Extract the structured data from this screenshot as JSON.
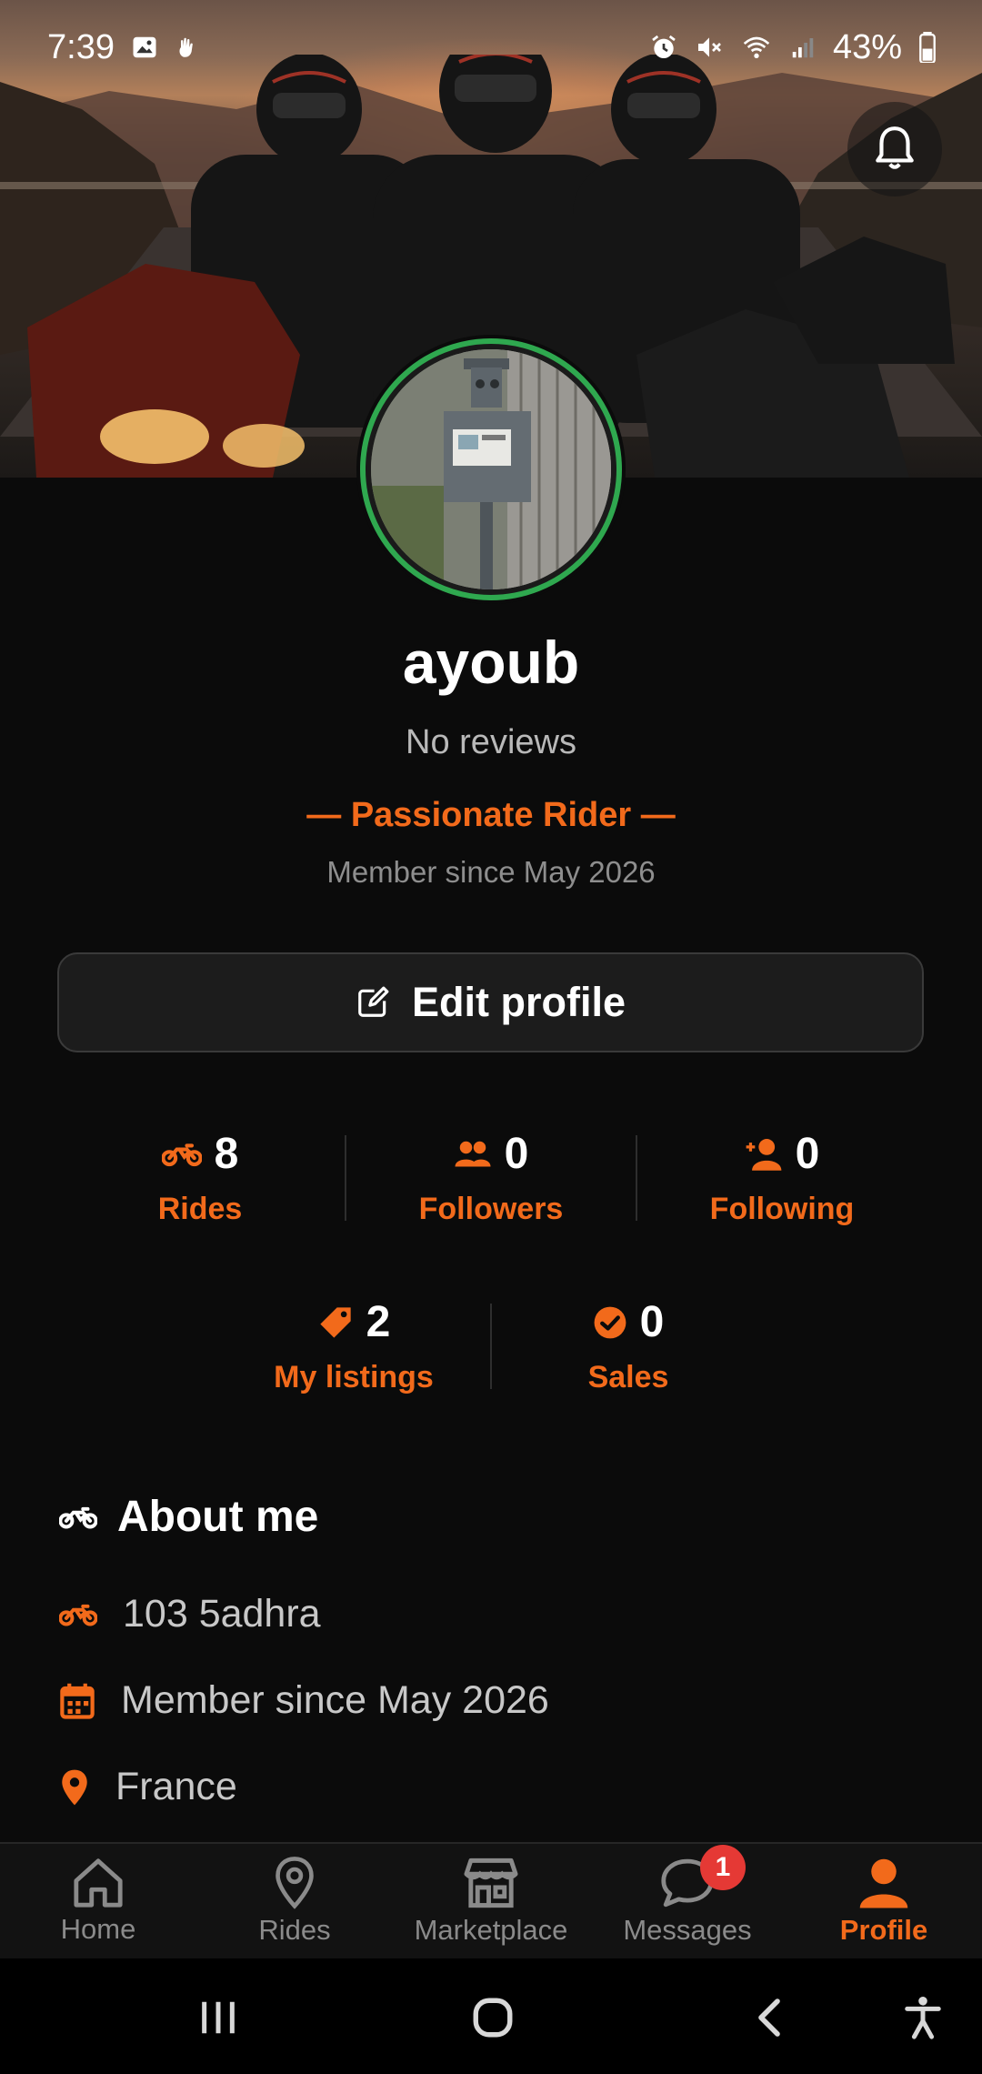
{
  "status_bar": {
    "time": "7:39",
    "battery": "43%",
    "left_icons": [
      "gallery-icon",
      "hand-icon"
    ],
    "right_icons": [
      "alarm-icon",
      "mute-icon",
      "wifi-icon",
      "signal-icon",
      "battery-icon"
    ]
  },
  "profile": {
    "username": "ayoub",
    "reviews": "No reviews",
    "title": "— Passionate Rider —",
    "member_since": "Member since May 2026"
  },
  "edit_profile": {
    "label": "Edit profile",
    "icon": "edit-icon"
  },
  "stats_primary": [
    {
      "icon": "motorcycle-icon",
      "value": "8",
      "label": "Rides"
    },
    {
      "icon": "followers-icon",
      "value": "0",
      "label": "Followers"
    },
    {
      "icon": "add-user-icon",
      "value": "0",
      "label": "Following"
    }
  ],
  "stats_secondary": [
    {
      "icon": "tag-icon",
      "value": "2",
      "label": "My listings"
    },
    {
      "icon": "check-circle-icon",
      "value": "0",
      "label": "Sales"
    }
  ],
  "about": {
    "heading": "About me",
    "items": [
      {
        "icon": "motorcycle-icon",
        "text": "103 5adhra"
      },
      {
        "icon": "calendar-icon",
        "text": "Member since May 2026"
      },
      {
        "icon": "location-pin-icon",
        "text": "France"
      }
    ]
  },
  "bottom_nav": {
    "items": [
      {
        "icon": "home-icon",
        "label": "Home"
      },
      {
        "icon": "map-pin-icon",
        "label": "Rides"
      },
      {
        "icon": "store-icon",
        "label": "Marketplace"
      },
      {
        "icon": "chat-icon",
        "label": "Messages",
        "badge": "1"
      },
      {
        "icon": "user-icon",
        "label": "Profile",
        "active": true
      }
    ]
  },
  "colors": {
    "accent": "#f26a1b",
    "background": "#0b0b0b",
    "avatar_ring": "#2fa84f",
    "badge": "#e53935"
  }
}
